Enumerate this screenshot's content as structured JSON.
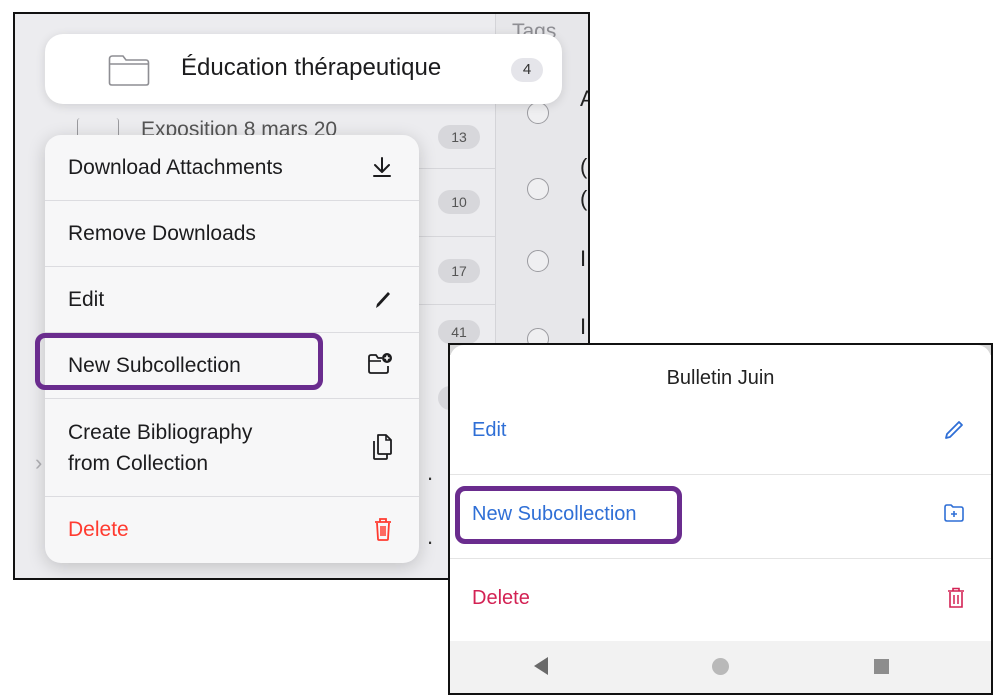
{
  "ios": {
    "tags_label": "Tags",
    "collection_pill": {
      "name": "Éducation thérapeutique",
      "count": "4"
    },
    "background_row": "Exposition 8 mars 20",
    "background_counts": [
      "13",
      "10",
      "17",
      "41"
    ],
    "menu": {
      "items": [
        {
          "label": "Download Attachments",
          "icon": "download-icon"
        },
        {
          "label": "Remove Downloads"
        },
        {
          "label": "Edit",
          "icon": "pencil-icon"
        },
        {
          "label": "New Subcollection",
          "icon": "folder-add-icon",
          "highlighted": true
        },
        {
          "label_line1": "Create Bibliography",
          "label_line2": "from Collection",
          "icon": "copy-document-icon"
        },
        {
          "label": "Delete",
          "icon": "trash-icon",
          "color": "#ff3b30"
        }
      ]
    }
  },
  "android": {
    "sheet_title": "Bulletin Juin",
    "items": [
      {
        "label": "Edit",
        "icon": "pencil-icon"
      },
      {
        "label": "New Subcollection",
        "icon": "folder-add-icon",
        "highlighted": true
      },
      {
        "label": "Delete",
        "icon": "trash-icon",
        "color": "#d32254"
      }
    ],
    "nav": [
      "back-icon",
      "home-icon",
      "recents-icon"
    ]
  },
  "colors": {
    "highlight": "#6a2c8e",
    "ios_destructive": "#ff3b30",
    "android_accent": "#2f6fd6"
  }
}
